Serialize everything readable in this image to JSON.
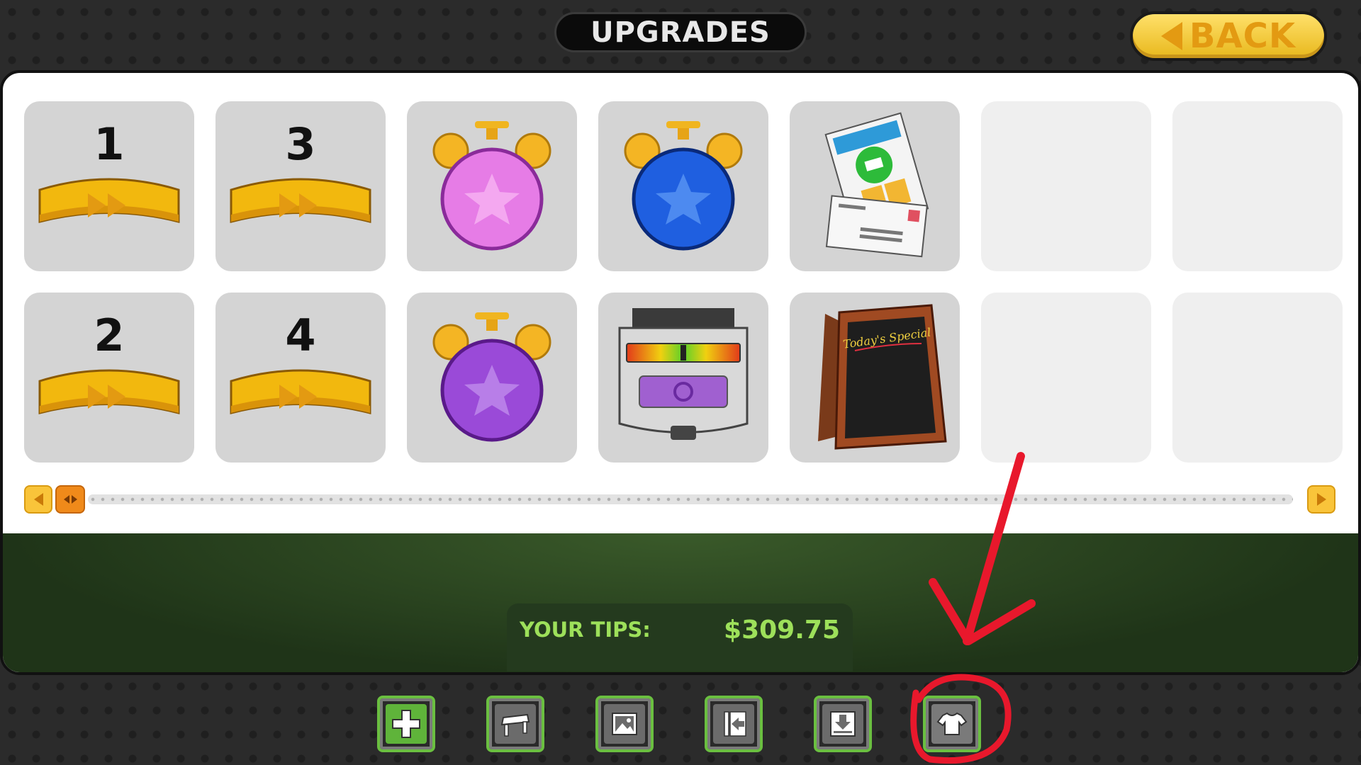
{
  "header": {
    "title": "UPGRADES",
    "back_label": "BACK"
  },
  "upgrades": {
    "row1": [
      {
        "kind": "speed",
        "number": "1"
      },
      {
        "kind": "speed",
        "number": "3"
      },
      {
        "kind": "alarm-clock-pink",
        "number": ""
      },
      {
        "kind": "alarm-clock-blue",
        "number": ""
      },
      {
        "kind": "coupons-mail",
        "number": ""
      },
      {
        "kind": "empty",
        "number": ""
      },
      {
        "kind": "empty",
        "number": ""
      }
    ],
    "row2": [
      {
        "kind": "speed",
        "number": "2"
      },
      {
        "kind": "speed",
        "number": "4"
      },
      {
        "kind": "alarm-clock-purple",
        "number": ""
      },
      {
        "kind": "heat-meter",
        "number": ""
      },
      {
        "kind": "specials-board",
        "number": "",
        "board_text": "Today's Special"
      },
      {
        "kind": "empty",
        "number": ""
      },
      {
        "kind": "empty",
        "number": ""
      }
    ]
  },
  "footer": {
    "tips_label": "YOUR TIPS:",
    "tips_value": "$309.75"
  },
  "toolbar": {
    "buttons": [
      "plus-icon",
      "table-icon",
      "picture-icon",
      "exit-icon",
      "download-icon",
      "shirt-icon"
    ]
  },
  "annotation": {
    "color": "#e8182c",
    "target": "shirt-icon"
  }
}
